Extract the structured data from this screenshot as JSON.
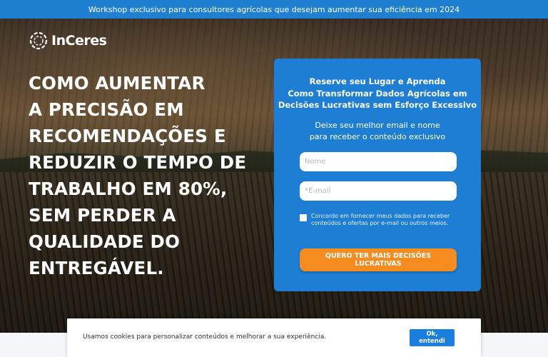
{
  "banner": {
    "text": "Workshop exclusivo para consultores agrícolas que desejam aumentar sua eficiência em 2024"
  },
  "logo": {
    "text": "InCeres",
    "icon": "chain-ring-icon"
  },
  "headline": {
    "lines": [
      "COMO AUMENTAR",
      "A PRECISÃO EM",
      "RECOMENDAÇÕES E",
      "REDUZIR O TEMPO DE",
      "TRABALHO EM 80%,",
      "SEM PERDER A",
      "QUALIDADE DO",
      "ENTREGÁVEL."
    ]
  },
  "form": {
    "title_lines": [
      "Reserve seu Lugar e Aprenda",
      "Como Transformar Dados Agrícolas em",
      "Decisões Lucrativas sem Esforço Excessivo"
    ],
    "subtitle_lines": [
      "Deixe seu melhor email e nome",
      "para receber o conteúdo exclusivo"
    ],
    "name_placeholder": "Nome",
    "name_value": "",
    "email_placeholder": "*E-mail",
    "email_value": "",
    "consent_text": "Concordo em fornecer meus dados para receber conteúdos e ofertas por e-mail ou outros meios.",
    "consent_checked": false,
    "submit_label": "QUERO TER MAIS DECISÕES LUCRATIVAS"
  },
  "cookie": {
    "text": "Usamos cookies para personalizar conteúdos e melhorar a sua experiência.",
    "button_label": "Ok, entendi"
  },
  "colors": {
    "banner": "#1f7fd1",
    "form_card": "#1d7ed3",
    "cta": "#f68b1f",
    "cookie_button": "#1a7ee0"
  }
}
